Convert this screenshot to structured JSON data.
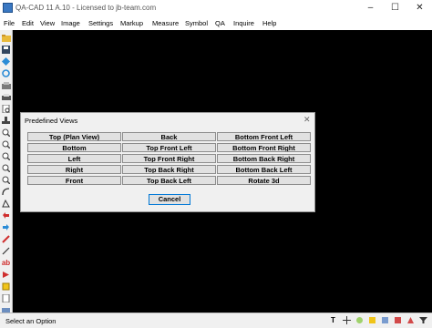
{
  "window": {
    "title": "QA-CAD 11 A.10 - Licensed to jb-team.com",
    "min_glyph": "–",
    "max_glyph": "☐",
    "close_glyph": "✕"
  },
  "menu": [
    "File",
    "Edit",
    "View",
    "Image",
    "Settings",
    "Markup",
    "Measure",
    "Symbol",
    "QA",
    "Inquire",
    "Help"
  ],
  "toolbar_icons": [
    "open-folder-icon",
    "save-icon",
    "pan-icon",
    "refresh-icon",
    "scan-icon",
    "print-icon",
    "print-preview-icon",
    "stamp-icon",
    "zoom-icon",
    "zoom-in-icon",
    "zoom-out-icon",
    "zoom-window-icon",
    "zoom-fit-icon",
    "rotate-icon",
    "shape-icon",
    "undo-icon",
    "redo-icon",
    "pencil-icon",
    "line-icon",
    "text-ab-icon",
    "arrow-icon",
    "marker-icon",
    "note-icon",
    "calc-icon",
    "color-icon",
    "edit-icon"
  ],
  "dialog": {
    "title": "Predefined Views",
    "close_glyph": "✕",
    "buttons": [
      [
        "Top (Plan View)",
        "Back",
        "Bottom Front Left"
      ],
      [
        "Bottom",
        "Top Front Left",
        "Bottom Front Right"
      ],
      [
        "Left",
        "Top Front Right",
        "Bottom Back Right"
      ],
      [
        "Right",
        "Top Back Right",
        "Bottom Back Left"
      ],
      [
        "Front",
        "Top Back Left",
        "Rotate 3d"
      ]
    ],
    "cancel_label": "Cancel"
  },
  "status": {
    "text": "Select an Option",
    "text_tool_glyph": "T"
  },
  "colors": {
    "canvas": "#000000",
    "dialog_bg": "#f0f0f0",
    "button_bg": "#e1e1e1",
    "focus_border": "#0078d7"
  }
}
